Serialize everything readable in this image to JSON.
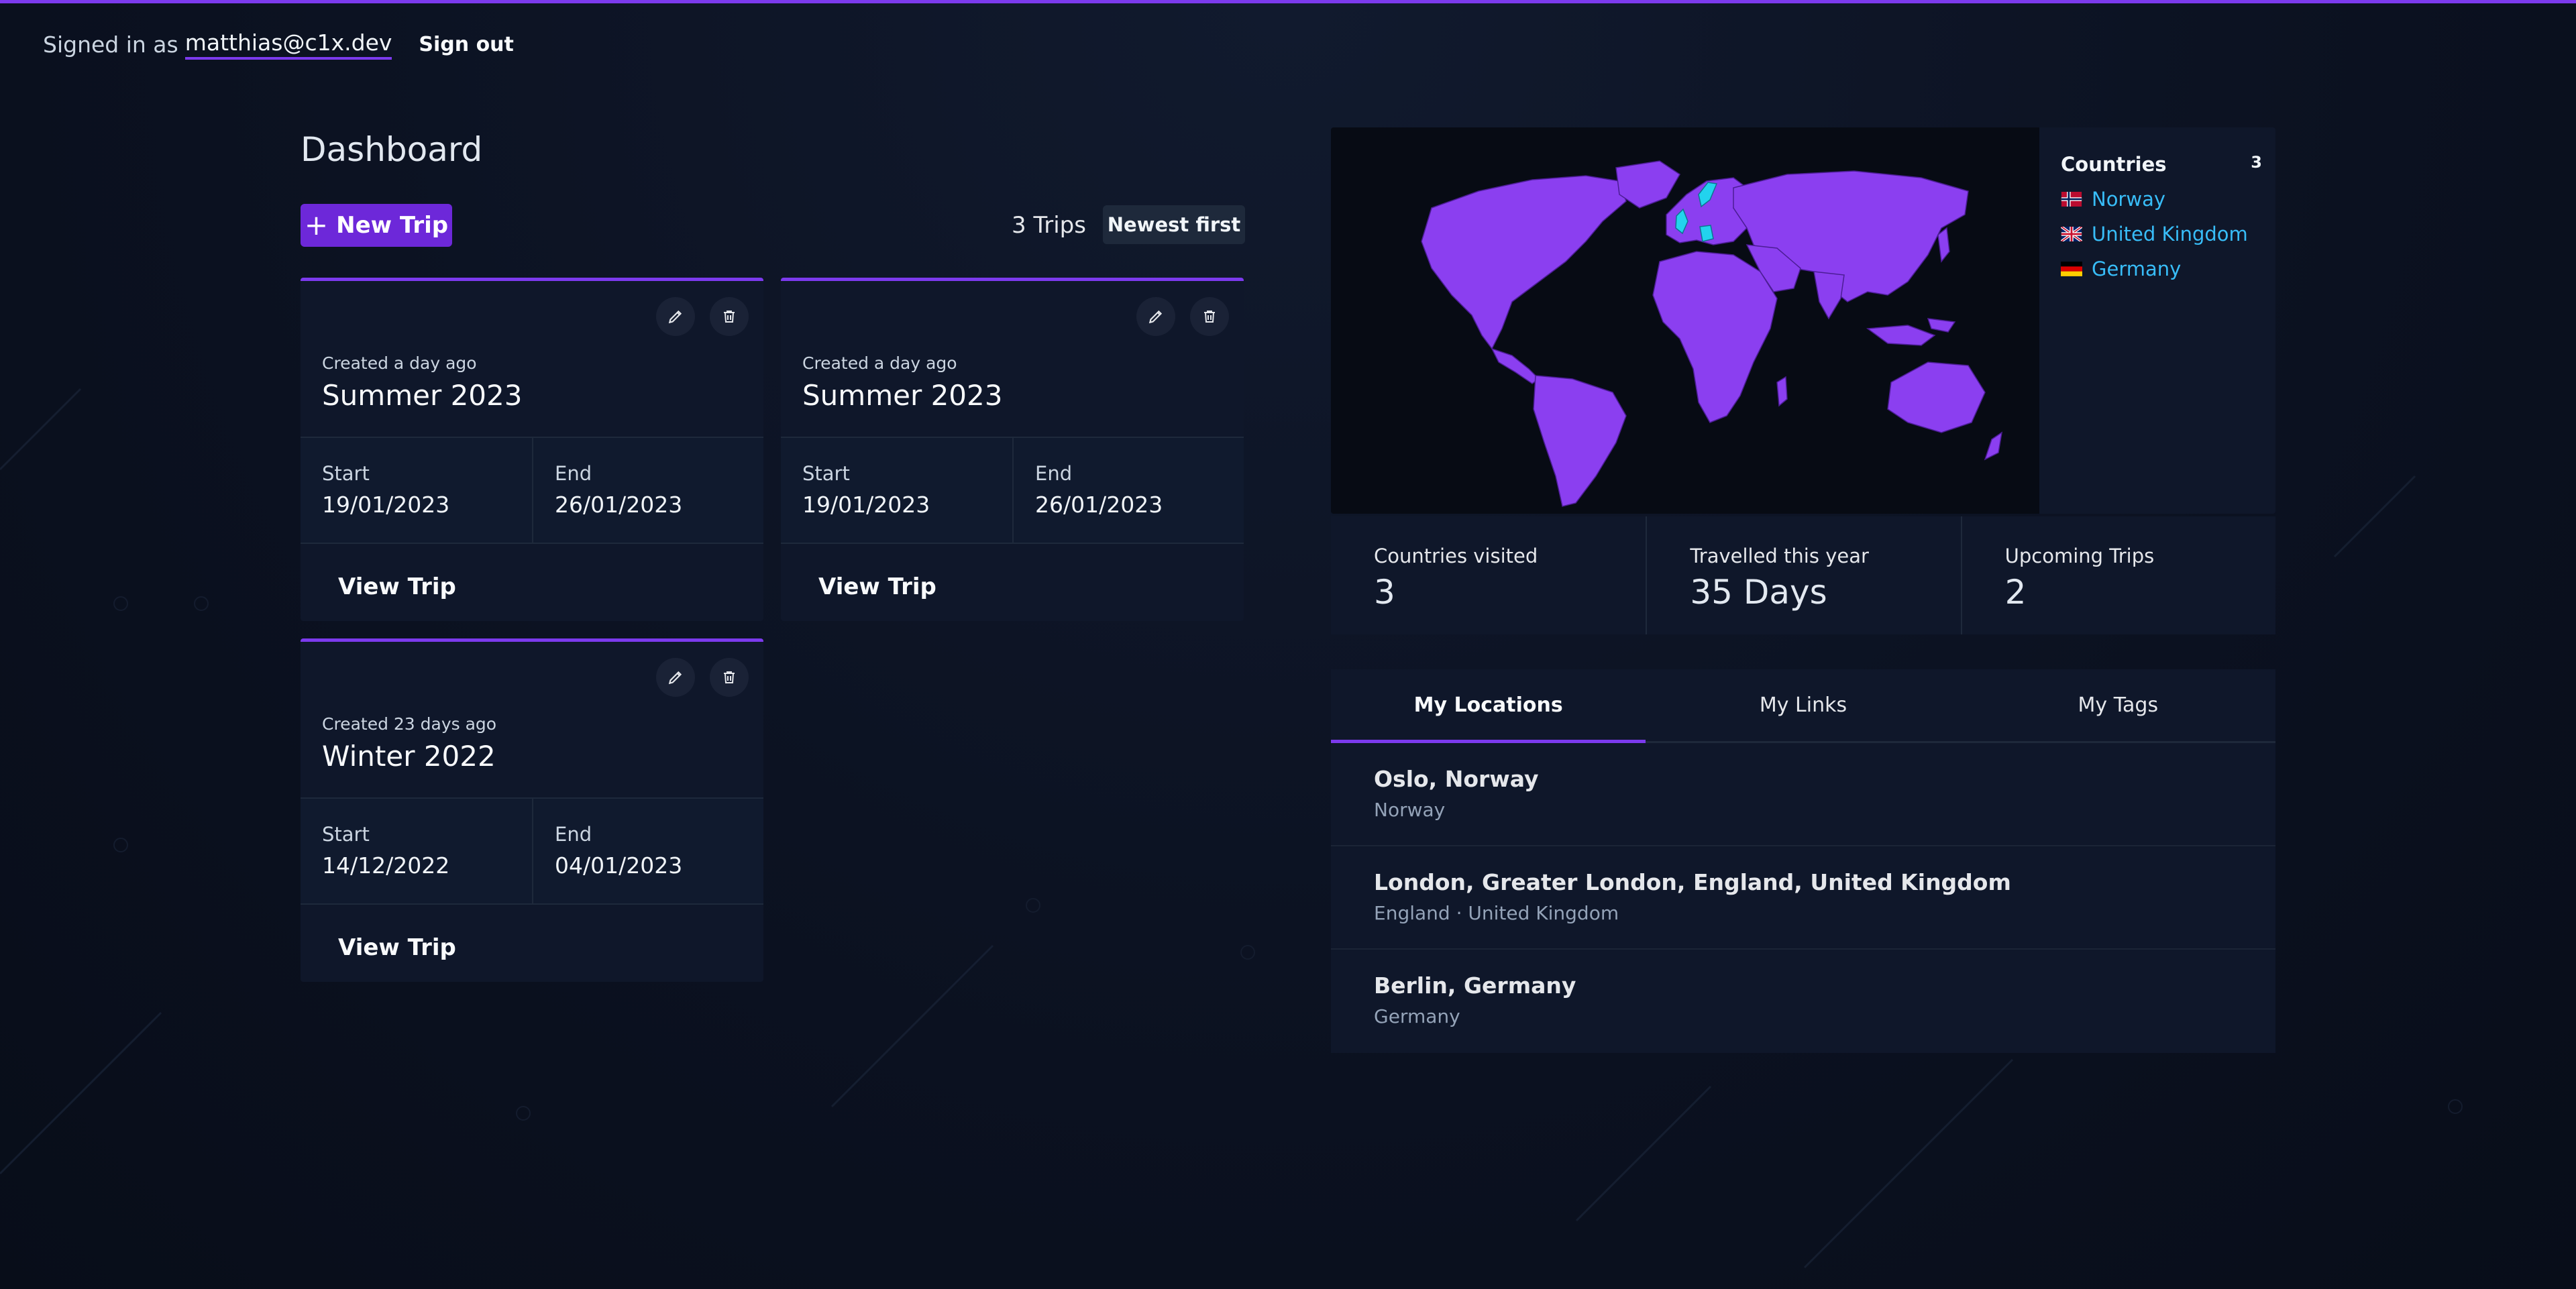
{
  "header": {
    "signed_in_prefix": "Signed in as",
    "email": "matthias@c1x.dev",
    "sign_out": "Sign out"
  },
  "dashboard": {
    "title": "Dashboard",
    "new_trip_label": "New Trip",
    "trip_count": "3 Trips",
    "sort_label": "Newest first"
  },
  "trips": [
    {
      "created": "Created a day ago",
      "name": "Summer 2023",
      "start_label": "Start",
      "start": "19/01/2023",
      "end_label": "End",
      "end": "26/01/2023",
      "view_label": "View Trip"
    },
    {
      "created": "Created a day ago",
      "name": "Summer 2023",
      "start_label": "Start",
      "start": "19/01/2023",
      "end_label": "End",
      "end": "26/01/2023",
      "view_label": "View Trip"
    },
    {
      "created": "Created 23 days ago",
      "name": "Winter 2022",
      "start_label": "Start",
      "start": "14/12/2022",
      "end_label": "End",
      "end": "04/01/2023",
      "view_label": "View Trip"
    }
  ],
  "countries": {
    "title": "Countries",
    "count": "3",
    "items": [
      "Norway",
      "United Kingdom",
      "Germany"
    ]
  },
  "stats": [
    {
      "label": "Countries visited",
      "value": "3"
    },
    {
      "label": "Travelled this year",
      "value": "35 Days"
    },
    {
      "label": "Upcoming Trips",
      "value": "2"
    }
  ],
  "tabs": [
    "My Locations",
    "My Links",
    "My Tags"
  ],
  "locations": [
    {
      "title": "Oslo, Norway",
      "sub": "Norway"
    },
    {
      "title": "London, Greater London, England, United Kingdom",
      "sub": "England · United Kingdom"
    },
    {
      "title": "Berlin, Germany",
      "sub": "Germany"
    }
  ],
  "colors": {
    "accent": "#7c3aed",
    "map_land": "#8b3ff0",
    "map_highlight": "#22d3ee",
    "link": "#38bdf8"
  }
}
